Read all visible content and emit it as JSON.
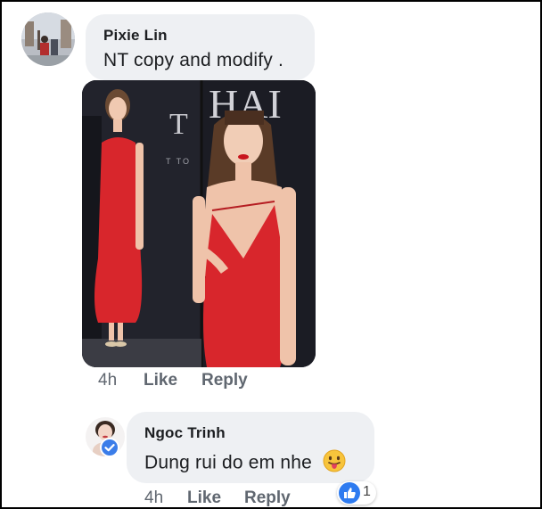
{
  "comments": [
    {
      "author": "Pixie Lin",
      "text": "NT copy and modify .",
      "time": "4h",
      "like_label": "Like",
      "reply_label": "Reply"
    },
    {
      "author": "Ngoc Trinh",
      "text": "Dung rui do em nhe",
      "emoji": "tongue-emoji",
      "time": "4h",
      "like_label": "Like",
      "reply_label": "Reply",
      "reaction_count": "1",
      "verified": true
    }
  ],
  "photo_signage": {
    "left_letters": "T",
    "left_small": "T  TO",
    "right_letters": "HAI"
  },
  "colors": {
    "bubble": "#eef0f3",
    "like_blue": "#2e7bf0",
    "dress_red": "#d8262c",
    "muted": "#606770"
  }
}
